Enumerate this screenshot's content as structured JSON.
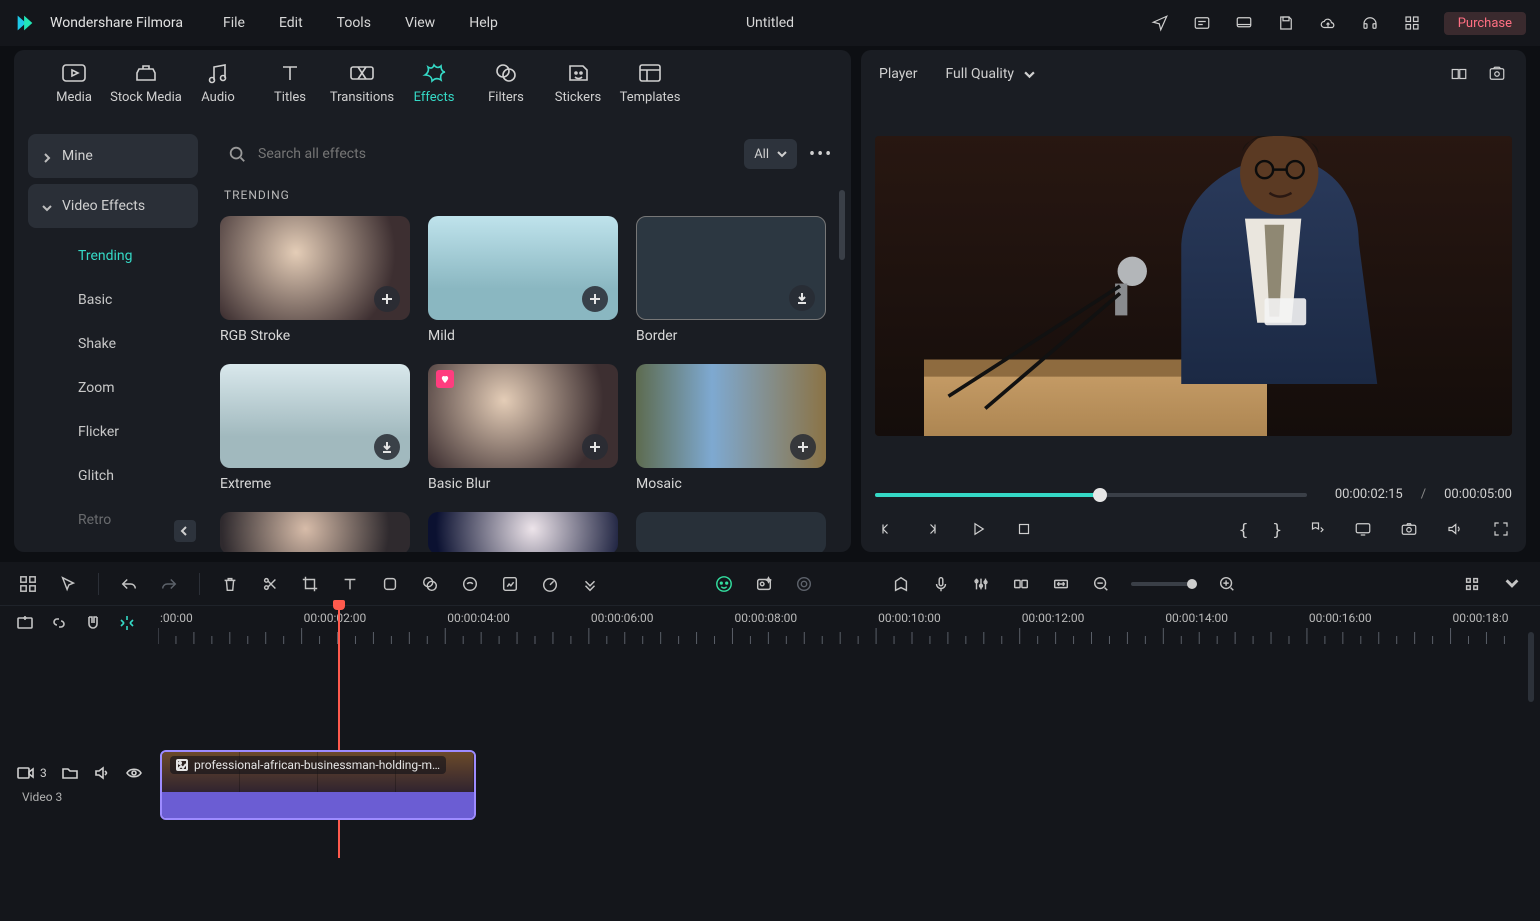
{
  "app": {
    "brand": "Wondershare Filmora",
    "documentTitle": "Untitled"
  },
  "menu": {
    "file": "File",
    "edit": "Edit",
    "tools": "Tools",
    "view": "View",
    "help": "Help"
  },
  "titleActions": {
    "purchase": "Purchase"
  },
  "library": {
    "tabs": {
      "media": "Media",
      "stock": "Stock Media",
      "audio": "Audio",
      "titles": "Titles",
      "transitions": "Transitions",
      "effects": "Effects",
      "filters": "Filters",
      "stickers": "Stickers",
      "templates": "Templates"
    },
    "activeTab": "effects",
    "side": {
      "mine": "Mine",
      "videoEffects": "Video Effects",
      "categories": [
        "Trending",
        "Basic",
        "Shake",
        "Zoom",
        "Flicker",
        "Glitch",
        "Retro"
      ],
      "activeCategory": "Trending"
    },
    "search": {
      "placeholder": "Search all effects",
      "filterAll": "All"
    },
    "sectionLabel": "TRENDING",
    "items": [
      {
        "name": "RGB Stroke"
      },
      {
        "name": "Mild"
      },
      {
        "name": "Border",
        "selected": true,
        "action": "download"
      },
      {
        "name": "Extreme",
        "action": "download"
      },
      {
        "name": "Basic Blur",
        "favorite": true
      },
      {
        "name": "Mosaic"
      }
    ]
  },
  "player": {
    "label": "Player",
    "quality": "Full Quality",
    "current": "00:00:02:15",
    "sep": "/",
    "duration": "00:00:05:00"
  },
  "timeline": {
    "marks": [
      ":00:00",
      "00:00:02:00",
      "00:00:04:00",
      "00:00:06:00",
      "00:00:08:00",
      "00:00:10:00",
      "00:00:12:00",
      "00:00:14:00",
      "00:00:16:00",
      "00:00:18:00"
    ],
    "track": {
      "index": "3",
      "name": "Video 3",
      "clipTitle": "professional-african-businessman-holding-m…"
    }
  }
}
